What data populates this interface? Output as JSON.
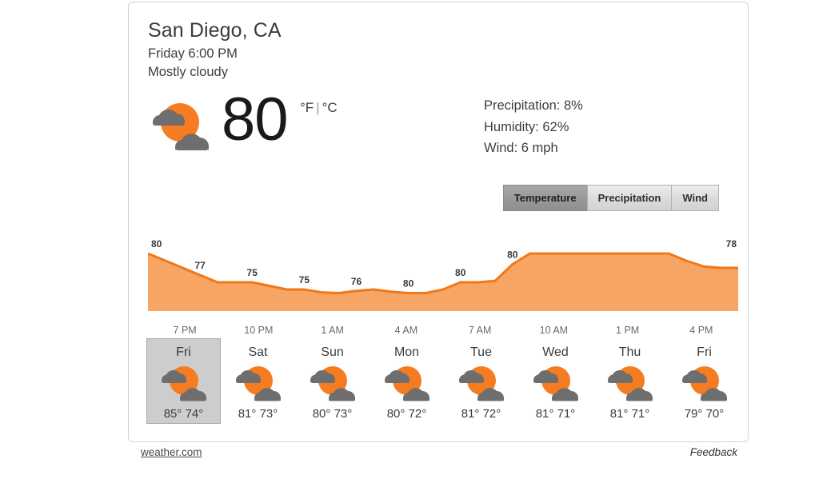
{
  "location": {
    "city": "San Diego, CA",
    "daytime": "Friday 6:00 PM",
    "condition": "Mostly cloudy"
  },
  "current": {
    "temperature": "80",
    "icon": "sun-behind-clouds-icon",
    "unit_f": "°F",
    "unit_separator": "|",
    "unit_c": "°C",
    "precipitation": "Precipitation: 8%",
    "humidity": "Humidity: 62%",
    "wind": "Wind: 6 mph"
  },
  "tabs": [
    {
      "label": "Temperature",
      "active": true
    },
    {
      "label": "Precipitation",
      "active": false
    },
    {
      "label": "Wind",
      "active": false
    }
  ],
  "chart_data": {
    "type": "area",
    "title": "",
    "xlabel": "",
    "ylabel": "",
    "categories": [
      "7 PM",
      "10 PM",
      "1 AM",
      "4 AM",
      "7 AM",
      "10 AM",
      "1 PM",
      "4 PM"
    ],
    "labeled_points": [
      {
        "label": "80",
        "x": 0
      },
      {
        "label": "77",
        "x": 3
      },
      {
        "label": "75",
        "x": 6
      },
      {
        "label": "75",
        "x": 9
      },
      {
        "label": "76",
        "x": 12
      },
      {
        "label": "80",
        "x": 15
      },
      {
        "label": "80",
        "x": 18
      },
      {
        "label": "80",
        "x": 21
      },
      {
        "label": "78",
        "x": 24
      }
    ],
    "values": [
      80,
      79,
      78,
      77,
      76,
      76,
      76,
      75.5,
      75,
      75,
      74.6,
      74.5,
      74.8,
      75,
      74.7,
      74.5,
      74.5,
      75,
      76,
      76,
      76.2,
      78.5,
      80,
      80,
      80,
      80,
      80,
      80,
      80,
      80,
      80,
      79,
      78.2,
      78,
      78
    ],
    "ylim": [
      72,
      82
    ],
    "grid": false,
    "legend": "none",
    "fill_color": "#F7A565",
    "line_color": "#F07818"
  },
  "forecast": [
    {
      "day": "Fri",
      "high": "85°",
      "low": "74°",
      "temps": "85° 74°",
      "icon": "sun-behind-clouds-icon",
      "selected": true
    },
    {
      "day": "Sat",
      "high": "81°",
      "low": "73°",
      "temps": "81° 73°",
      "icon": "sun-behind-clouds-icon",
      "selected": false
    },
    {
      "day": "Sun",
      "high": "80°",
      "low": "73°",
      "temps": "80° 73°",
      "icon": "sun-behind-clouds-icon",
      "selected": false
    },
    {
      "day": "Mon",
      "high": "80°",
      "low": "72°",
      "temps": "80° 72°",
      "icon": "sun-behind-clouds-icon",
      "selected": false
    },
    {
      "day": "Tue",
      "high": "81°",
      "low": "72°",
      "temps": "81° 72°",
      "icon": "sun-behind-clouds-icon",
      "selected": false
    },
    {
      "day": "Wed",
      "high": "81°",
      "low": "71°",
      "temps": "81° 71°",
      "icon": "sun-behind-clouds-icon",
      "selected": false
    },
    {
      "day": "Thu",
      "high": "81°",
      "low": "71°",
      "temps": "81° 71°",
      "icon": "sun-behind-clouds-icon",
      "selected": false
    },
    {
      "day": "Fri",
      "high": "79°",
      "low": "70°",
      "temps": "79° 70°",
      "icon": "sun-behind-clouds-icon",
      "selected": false
    }
  ],
  "footer": {
    "source_link": "weather.com",
    "feedback": "Feedback"
  },
  "colors": {
    "sun": "#F57C20",
    "cloud": "#6E6E6E",
    "area_fill": "#F7A565",
    "area_line": "#F07818",
    "selected_bg": "#CDCDCD",
    "text": "#3B3B3B"
  }
}
